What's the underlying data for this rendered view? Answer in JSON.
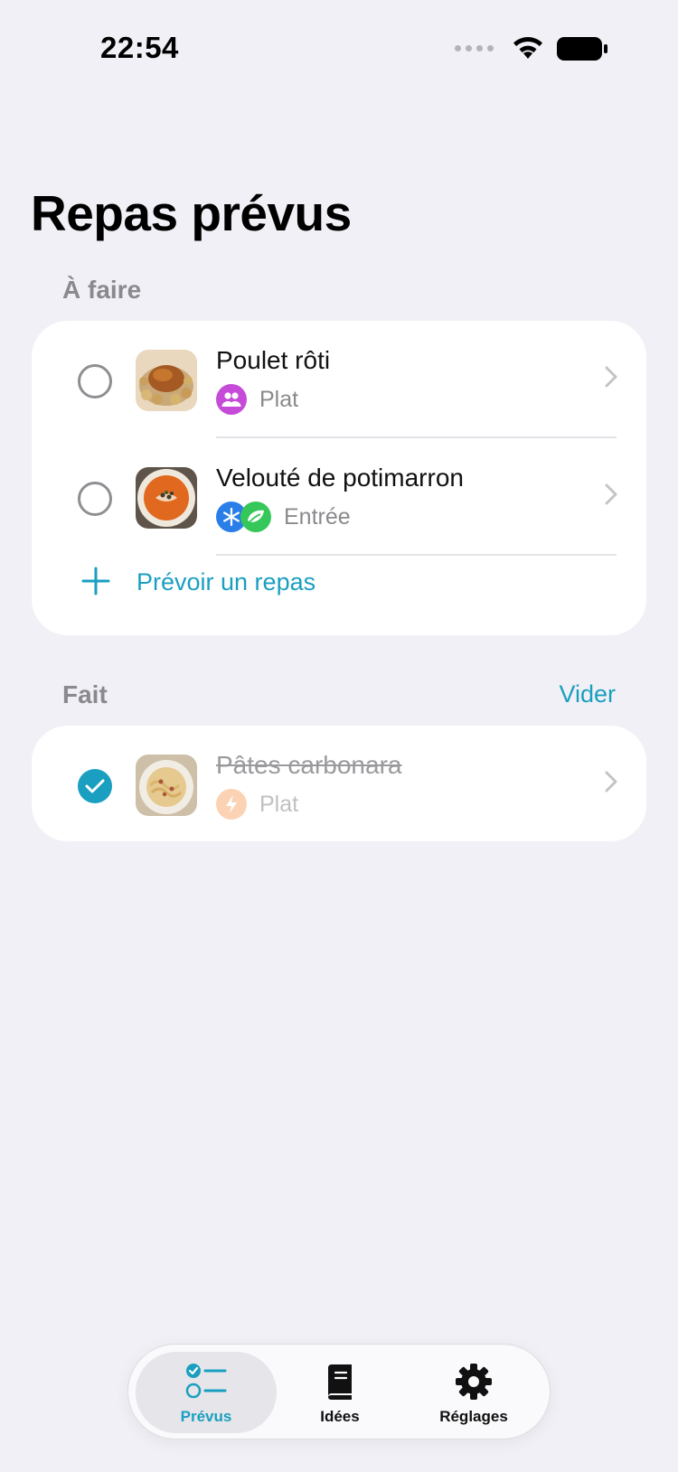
{
  "status_bar": {
    "time": "22:54"
  },
  "page": {
    "title": "Repas prévus"
  },
  "sections": {
    "todo": {
      "header": "À faire",
      "meals": [
        {
          "name": "Poulet rôti",
          "course": "Plat",
          "badges": [
            "people-icon"
          ],
          "image": "roast-chicken"
        },
        {
          "name": "Velouté de potimarron",
          "course": "Entrée",
          "badges": [
            "snowflake-icon",
            "leaf-icon"
          ],
          "image": "pumpkin-soup"
        }
      ],
      "add_label": "Prévoir un repas"
    },
    "done": {
      "header": "Fait",
      "clear_label": "Vider",
      "meals": [
        {
          "name": "Pâtes carbonara",
          "course": "Plat",
          "badges": [
            "lightning-icon"
          ],
          "image": "pasta-carbonara",
          "checked": true
        }
      ]
    }
  },
  "tab_bar": {
    "tabs": [
      {
        "label": "Prévus",
        "icon": "checklist-icon",
        "active": true
      },
      {
        "label": "Idées",
        "icon": "book-icon",
        "active": false
      },
      {
        "label": "Réglages",
        "icon": "gear-icon",
        "active": false
      }
    ]
  },
  "colors": {
    "accent": "#1a9fc0",
    "background": "#f1f0f6",
    "card": "#ffffff"
  }
}
